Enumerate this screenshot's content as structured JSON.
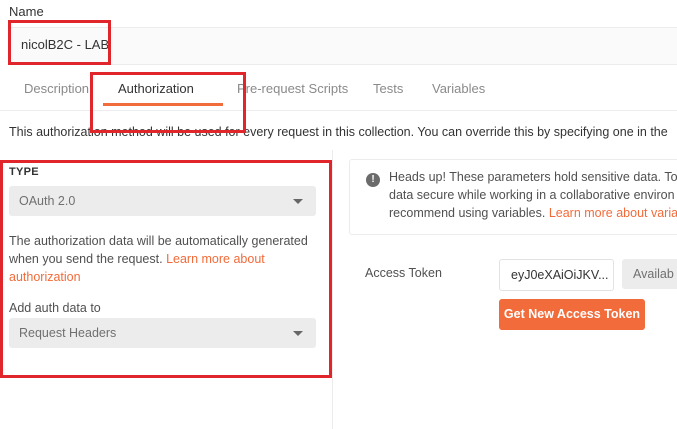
{
  "collection": {
    "name_label": "Name",
    "name_value": "nicolB2C - LAB"
  },
  "tabs": [
    {
      "label": "Description"
    },
    {
      "label": "Authorization",
      "active": true
    },
    {
      "label": "Pre-request Scripts"
    },
    {
      "label": "Tests"
    },
    {
      "label": "Variables"
    }
  ],
  "info_text": "This authorization method will be used for every request in this collection. You can override this by specifying one in the",
  "auth": {
    "type_label": "TYPE",
    "type_value": "OAuth 2.0",
    "description": "The authorization data will be automatically generated when you send the request.",
    "learn_more": "Learn more about authorization",
    "add_auth_label": "Add auth data to",
    "add_auth_value": "Request Headers"
  },
  "heads_up": {
    "line1": "Heads up! These parameters hold sensitive data. To",
    "line2": "data secure while working in a collaborative environ",
    "line3": "recommend using variables.",
    "link": "Learn more about varia"
  },
  "token": {
    "label": "Access Token",
    "value": "eyJ0eXAiOiJKV...",
    "available_label": "Availab",
    "get_button": "Get New Access Token"
  },
  "colors": {
    "accent": "#f26b3a",
    "highlight_box": "#e0252b"
  }
}
